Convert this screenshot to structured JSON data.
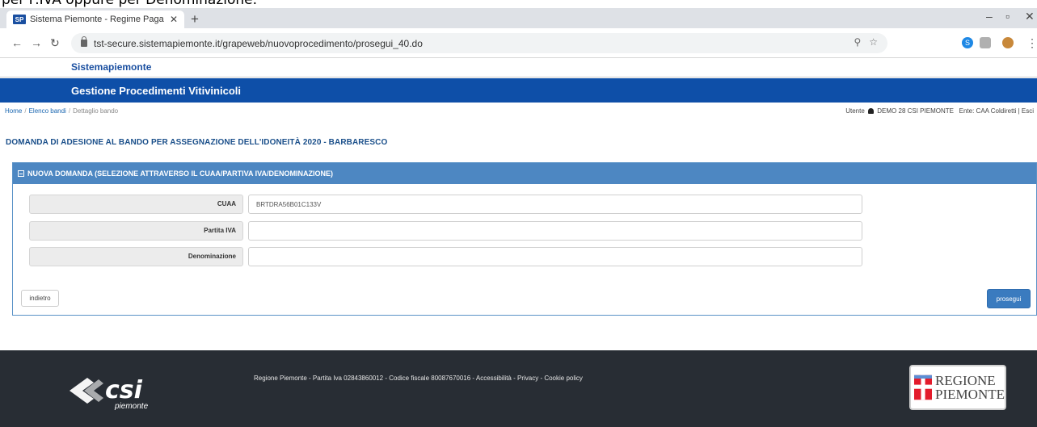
{
  "caption": "per P.IVA oppure per Denominazione.",
  "browser": {
    "tab_title": "Sistema Piemonte - Regime Paga",
    "tab_favicon": "SP",
    "url": "tst-secure.sistemapiemonte.it/grapeweb/nuovoprocedimento/prosegui_40.do"
  },
  "app": {
    "brand": "Sistemapiemonte",
    "title": "Gestione Procedimenti Vitivinicoli"
  },
  "breadcrumb": {
    "home": "Home",
    "elenco": "Elenco bandi",
    "dettaglio": "Dettaglio bando"
  },
  "user": {
    "label": "Utente",
    "name": "DEMO 28 CSI PIEMONTE",
    "ente": "Ente: CAA Coldiretti |",
    "logout": "Esci"
  },
  "page": {
    "title": "DOMANDA DI ADESIONE AL BANDO PER ASSEGNAZIONE DELL'IDONEITÀ 2020 - BARBARESCO"
  },
  "panel": {
    "title": "NUOVA DOMANDA (SELEZIONE ATTRAVERSO IL CUAA/PARTIVA IVA/DENOMINAZIONE)",
    "fields": [
      {
        "label": "CUAA",
        "value": "BRTDRA56B01C133V"
      },
      {
        "label": "Partita IVA",
        "value": ""
      },
      {
        "label": "Denominazione",
        "value": ""
      }
    ],
    "back_label": "indietro",
    "next_label": "prosegui"
  },
  "footer": {
    "csi_brand": "csi",
    "csi_sub": "piemonte",
    "info": "Regione Piemonte - Partita Iva 02843860012 - Codice fiscale 80087670016 - ",
    "link_accessibilita": "Accessibilità",
    "link_privacy": "Privacy",
    "link_cookie": "Cookie policy",
    "region_line1": "REGIONE",
    "region_line2": "PIEMONTE"
  },
  "colors": {
    "app_bar": "#0e4fa8",
    "panel_head": "#4d87c2",
    "footer_bg": "#282d34",
    "primary_button": "#3a7bbf"
  }
}
